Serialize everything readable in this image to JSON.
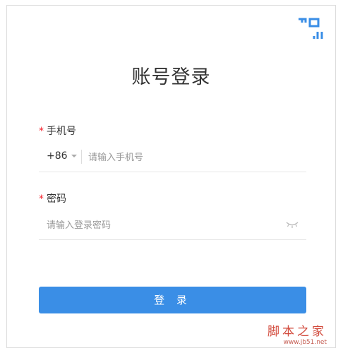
{
  "form": {
    "title": "账号登录",
    "phone": {
      "required_mark": "*",
      "label": "手机号",
      "country_code": "+86",
      "placeholder": "请输入手机号"
    },
    "password": {
      "required_mark": "*",
      "label": "密码",
      "placeholder": "请输入登录密码"
    },
    "submit_label": "登 录"
  },
  "icons": {
    "qr_toggle": "qr-code-corner-icon",
    "password_visibility": "eye-closed-icon",
    "country_caret": "caret-down-icon"
  },
  "watermark": {
    "title": "脚本之家",
    "url": "www.jb51.net"
  },
  "colors": {
    "primary": "#3a8ee6",
    "required": "#f5222d",
    "watermark": "#d24a3c"
  }
}
